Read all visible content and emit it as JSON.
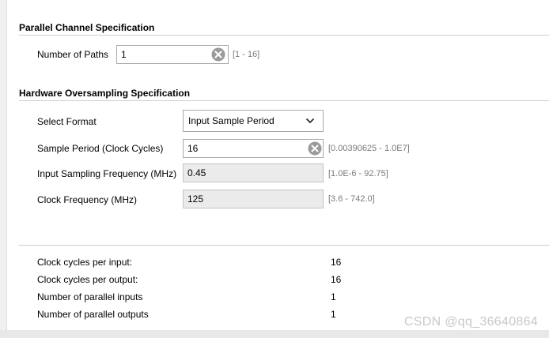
{
  "parallel": {
    "title": "Parallel Channel Specification",
    "paths_label": "Number of Paths",
    "paths_value": "1",
    "paths_range": "[1 - 16]"
  },
  "hardware": {
    "title": "Hardware Oversampling Specification",
    "format_label": "Select Format",
    "format_value": "Input Sample Period",
    "period_label": "Sample Period (Clock Cycles)",
    "period_value": "16",
    "period_range": "[0.00390625 - 1.0E7]",
    "freq_label": "Input Sampling Frequency (MHz)",
    "freq_value": "0.45",
    "freq_range": "[1.0E-6 - 92.75]",
    "clock_label": "Clock Frequency (MHz)",
    "clock_value": "125",
    "clock_range": "[3.6 - 742.0]"
  },
  "summary": {
    "rows": [
      {
        "label": "Clock cycles per input:",
        "value": "16"
      },
      {
        "label": "Clock cycles per output:",
        "value": "16"
      },
      {
        "label": "Number of parallel inputs",
        "value": "1"
      },
      {
        "label": "Number of parallel outputs",
        "value": "1"
      }
    ]
  },
  "watermark": "CSDN @qq_36640864",
  "icons": {
    "clear": "clear-icon",
    "dropdown": "chevron-down-icon"
  },
  "colors": {
    "clear_icon": "#9a9a9a",
    "readonly_bg": "#ebebeb"
  }
}
